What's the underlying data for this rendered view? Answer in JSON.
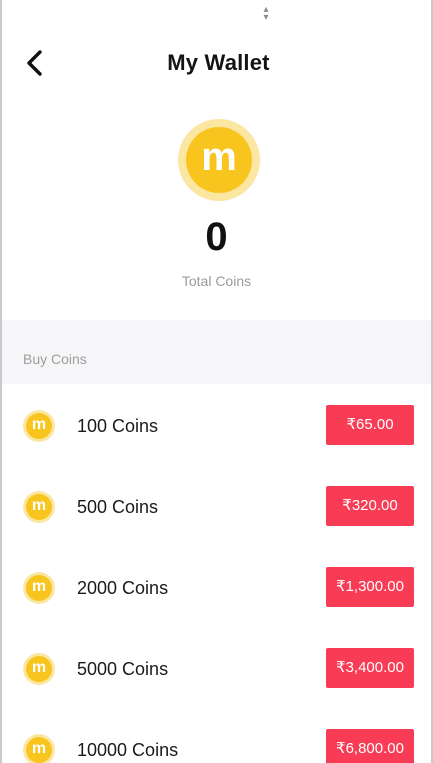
{
  "header": {
    "title": "My Wallet",
    "back_icon": "chevron-left-icon"
  },
  "wallet": {
    "coin_icon_letter": "m",
    "total_value": "0",
    "total_label": "Total Coins"
  },
  "buy_section": {
    "label": "Buy Coins"
  },
  "packages": [
    {
      "coins": "100 Coins",
      "price": "₹65.00"
    },
    {
      "coins": "500 Coins",
      "price": "₹320.00"
    },
    {
      "coins": "2000 Coins",
      "price": "₹1,300.00"
    },
    {
      "coins": "5000 Coins",
      "price": "₹3,400.00"
    },
    {
      "coins": "10000 Coins",
      "price": "₹6,800.00"
    }
  ],
  "colors": {
    "coin_gold": "#f7c51e",
    "coin_halo": "#fbe7a1",
    "price_red": "#f83c55",
    "section_bg": "#f6f6f8"
  }
}
